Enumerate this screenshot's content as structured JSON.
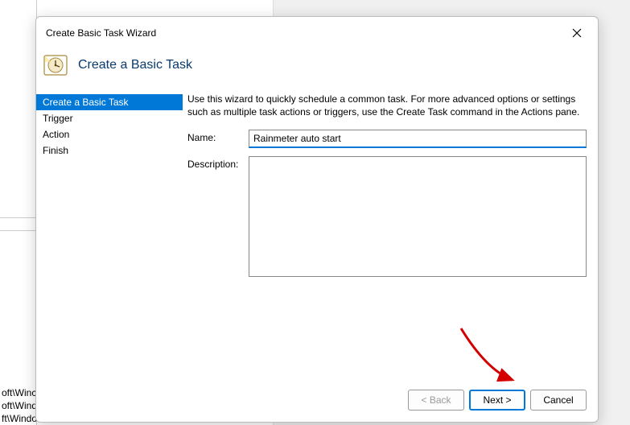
{
  "dialog": {
    "title": "Create Basic Task Wizard",
    "header_title": "Create a Basic Task",
    "intro": "Use this wizard to quickly schedule a common task.  For more advanced options or settings such as multiple task actions or triggers, use the Create Task command in the Actions pane.",
    "name_label": "Name:",
    "name_value": "Rainmeter auto start",
    "desc_label": "Description:",
    "desc_value": ""
  },
  "sidebar": {
    "items": [
      {
        "label": "Create a Basic Task",
        "active": true
      },
      {
        "label": "Trigger",
        "active": false
      },
      {
        "label": "Action",
        "active": false
      },
      {
        "label": "Finish",
        "active": false
      }
    ]
  },
  "footer": {
    "back_label": "< Back",
    "next_label": "Next >",
    "cancel_label": "Cancel"
  },
  "background": {
    "line1": "oft\\Winc",
    "line2": "oft\\Windows\\U...",
    "line3": "ft\\Windows\\Fli"
  }
}
